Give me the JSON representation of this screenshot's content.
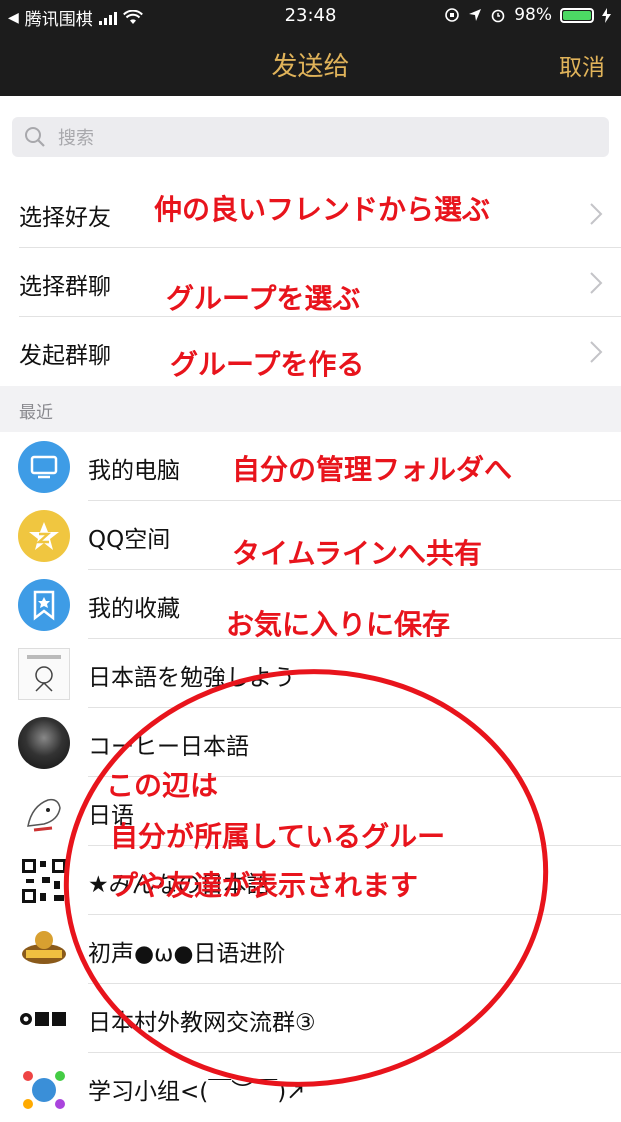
{
  "status_bar": {
    "carrier": "腾讯围棋",
    "time": "23:48",
    "battery": "98%"
  },
  "nav": {
    "title": "发送给",
    "cancel": "取消"
  },
  "search": {
    "placeholder": "搜索"
  },
  "menu": [
    {
      "label": "选择好友"
    },
    {
      "label": "选择群聊"
    },
    {
      "label": "发起群聊"
    }
  ],
  "recent_header": "最近",
  "recent": [
    {
      "name": "我的电脑",
      "icon": "computer-icon"
    },
    {
      "name": "QQ空间",
      "icon": "qzone-star-icon"
    },
    {
      "name": "我的收藏",
      "icon": "favorites-bookmark-icon"
    },
    {
      "name": "日本語を勉強しよう"
    },
    {
      "name": "コーヒー日本語"
    },
    {
      "name": "日语"
    },
    {
      "name": "★みんなの日本語"
    },
    {
      "name": "初声●ω●日语进阶"
    },
    {
      "name": "日本村外教网交流群③"
    },
    {
      "name": "学习小组<(￣︶￣)↗"
    }
  ],
  "annotations": {
    "select_friends": "仲の良いフレンドから選ぶ",
    "select_group": "グループを選ぶ",
    "create_group": "グループを作る",
    "my_computer": "自分の管理フォルダへ",
    "qzone": "タイムラインへ共有",
    "favorites": "お気に入りに保存",
    "circle_line1": "この辺は",
    "circle_line2": "自分が所属しているグルー",
    "circle_line3": "プや友達が表示されます"
  },
  "colors": {
    "nav_bg": "#1c1c1c",
    "accent_gold": "#e0b35a",
    "annotation_red": "#e8141c",
    "computer_icon_bg": "#3e9ce6",
    "qzone_icon_bg": "#f0c640",
    "favorites_icon_bg": "#3e9ce6"
  }
}
